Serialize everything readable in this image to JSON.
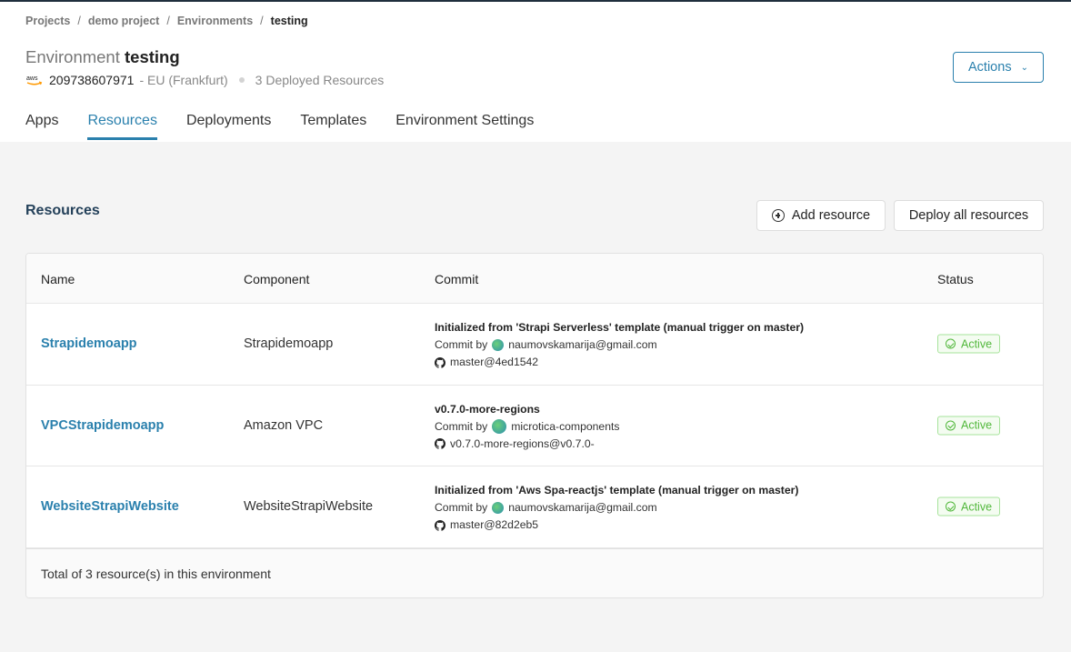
{
  "breadcrumb": [
    "Projects",
    "demo project",
    "Environments",
    "testing"
  ],
  "header": {
    "title_prefix": "Environment",
    "title_name": "testing",
    "provider_icon": "aws-logo",
    "account_id": "209738607971",
    "region": "- EU (Frankfurt)",
    "deployed_resources": "3 Deployed Resources",
    "actions_label": "Actions",
    "actions_icon": "chevron-down-icon"
  },
  "tabs": [
    {
      "label": "Apps",
      "active": false
    },
    {
      "label": "Resources",
      "active": true
    },
    {
      "label": "Deployments",
      "active": false
    },
    {
      "label": "Templates",
      "active": false
    },
    {
      "label": "Environment Settings",
      "active": false
    }
  ],
  "section": {
    "title": "Resources",
    "add_label": "Add resource",
    "deploy_label": "Deploy all resources"
  },
  "table": {
    "columns": [
      "Name",
      "Component",
      "Commit",
      "Status"
    ],
    "rows": [
      {
        "name": "Strapidemoapp",
        "component": "Strapidemoapp",
        "commit_message": "Initialized from 'Strapi Serverless' template (manual trigger on master)",
        "commit_by_label": "Commit by",
        "commit_author": "naumovskamarija@gmail.com",
        "ref": "master@4ed1542",
        "status": "Active"
      },
      {
        "name": "VPCStrapidemoapp",
        "component": "Amazon VPC",
        "commit_message": "v0.7.0-more-regions",
        "commit_by_label": "Commit by",
        "commit_author": "microtica-components",
        "ref": "v0.7.0-more-regions@v0.7.0-",
        "status": "Active"
      },
      {
        "name": "WebsiteStrapiWebsite",
        "component": "WebsiteStrapiWebsite",
        "commit_message": "Initialized from 'Aws Spa-reactjs' template (manual trigger on master)",
        "commit_by_label": "Commit by",
        "commit_author": "naumovskamarija@gmail.com",
        "ref": "master@82d2eb5",
        "status": "Active"
      }
    ],
    "footer": "Total of 3 resource(s) in this environment"
  },
  "colors": {
    "accent": "#2a80ad",
    "active_green": "#52b83c",
    "section_title": "#24415a"
  }
}
